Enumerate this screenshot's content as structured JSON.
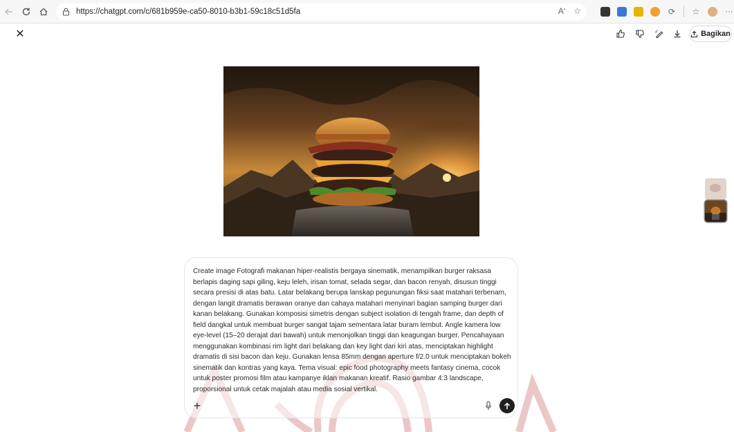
{
  "browser": {
    "url": "https://chatgpt.com/c/681b959e-ca50-8010-b3b1-59c18c51d5fa",
    "read_aloud": "Aʹ",
    "more": "···"
  },
  "header": {
    "close_glyph": "✕",
    "share_label": "Bagikan"
  },
  "prompt": {
    "text": "Create image Fotografi makanan hiper-realistis bergaya sinematik, menampilkan burger raksasa berlapis daging sapi giling, keju leleh, irisan tomat, selada segar, dan bacon renyah, disusun tinggi secara presisi di atas batu. Latar belakang berupa lanskap pegunungan fiksi saat matahari terbenam, dengan langit dramatis berawan oranye dan cahaya matahari menyinari bagian samping burger dari kanan belakang. Gunakan komposisi simetris dengan subject isolation di tengah frame, dan depth of field dangkal untuk membuat burger sangat tajam sementara latar buram lembut. Angle kamera low eye-level (15–20 derajat dari bawah) untuk menonjolkan tinggi dan keagungan burger. Pencahayaan menggunakan kombinasi rim light dari belakang dan key light dari kiri atas, menciptakan highlight dramatis di sisi bacon dan keju. Gunakan lensa 85mm dengan aperture f/2.0 untuk menciptakan bokeh sinematik dan kontras yang kaya. Tema visual: epic food photography meets fantasy cinema, cocok untuk poster promosi film atau kampanye iklan makanan kreatif. Rasio gambar 4:3 landscape, proporsional untuk cetak majalah atau media sosial vertikal.",
    "plus_glyph": "+"
  },
  "colors": {
    "watermark": "#b83a3a",
    "send_button": "#1f1f1f"
  }
}
